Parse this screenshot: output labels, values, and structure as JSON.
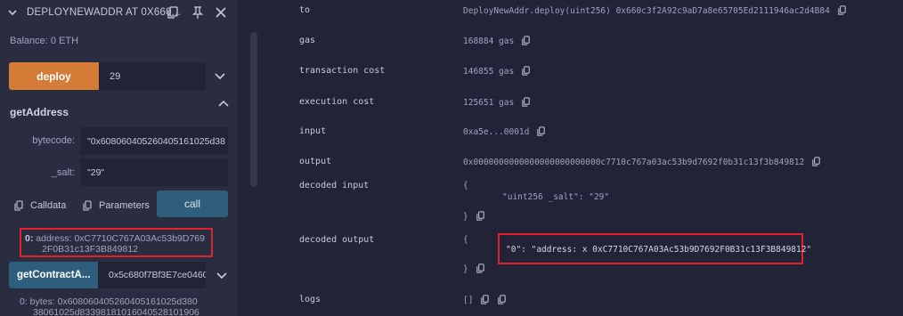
{
  "panel": {
    "title": "DEPLOYNEWADDR AT 0X660...",
    "balance": "Balance: 0 ETH",
    "deploy": {
      "label": "deploy",
      "value": "29"
    },
    "function": {
      "name": "getAddress",
      "params": [
        {
          "label": "bytecode:",
          "value": "\"0x608060405260405161025d38"
        },
        {
          "label": "_salt:",
          "value": "\"29\""
        }
      ],
      "calldata_label": "Calldata",
      "parameters_label": "Parameters",
      "call_label": "call",
      "result_index": "0:",
      "result_line1": "address: 0xC7710C767A03Ac53b9D769",
      "result_line2": "2F0B31c13F3B849812"
    },
    "function2": {
      "label": "getContractA...",
      "value": "0x5c680f7Bf3E7ce04603",
      "bytes_line1": "0: bytes: 0x608060405260405161025d380",
      "bytes_line2": "38061025d83398181016040528101906"
    }
  },
  "receipt": {
    "rows": [
      {
        "key": "to",
        "value": "DeployNewAddr.deploy(uint256) 0x660c3f2A92c9aD7a8e65705Ed2111946ac2d4B84"
      },
      {
        "key": "gas",
        "value": "168884 gas"
      },
      {
        "key": "transaction cost",
        "value": "146855 gas"
      },
      {
        "key": "execution cost",
        "value": "125651 gas"
      },
      {
        "key": "input",
        "value": "0xa5e...0001d"
      },
      {
        "key": "output",
        "value": "0x0000000000000000000000000c7710c767a03ac53b9d7692f0b31c13f3b849812"
      }
    ],
    "decoded_input": {
      "key": "decoded input",
      "open": "{",
      "line": "\"uint256 _salt\": \"29\"",
      "close": "}"
    },
    "decoded_output": {
      "key": "decoded output",
      "open": "{",
      "line": "\"0\": \"address: x 0xC7710C767A03Ac53b9D7692F0B31c13F3B849812\"",
      "close": "}"
    },
    "logs": {
      "key": "logs",
      "value": "[]"
    }
  },
  "colors": {
    "background": "#222336",
    "panel": "#2a2c3f",
    "deploy_button": "#d57c38",
    "call_button": "#2f5e7c",
    "highlight": "#e0222c"
  }
}
